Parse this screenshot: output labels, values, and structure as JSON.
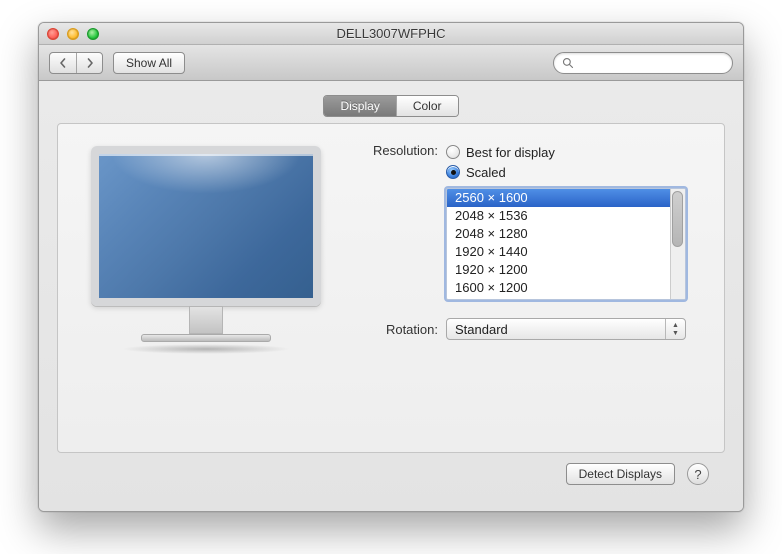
{
  "window_title": "DELL3007WFPHC",
  "toolbar": {
    "show_all_label": "Show All",
    "search_placeholder": ""
  },
  "tabs": {
    "display": "Display",
    "color": "Color"
  },
  "resolution": {
    "label": "Resolution:",
    "best_label": "Best for display",
    "scaled_label": "Scaled",
    "options": [
      "2560 × 1600",
      "2048 × 1536",
      "2048 × 1280",
      "1920 × 1440",
      "1920 × 1200",
      "1600 × 1200"
    ]
  },
  "rotation": {
    "label": "Rotation:",
    "value": "Standard"
  },
  "footer": {
    "detect_label": "Detect Displays",
    "help_label": "?"
  }
}
